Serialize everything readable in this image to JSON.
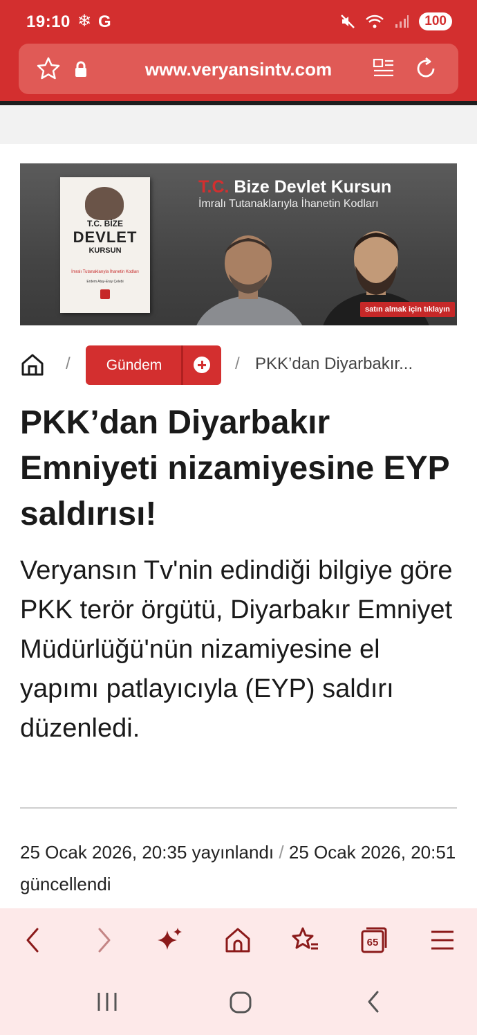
{
  "status_bar": {
    "time": "19:10",
    "carrier_glyph": "G",
    "battery": "100"
  },
  "browser": {
    "url": "www.veryansintv.com",
    "accent_color": "#d32f2f"
  },
  "banner": {
    "title_prefix": "T.C.",
    "title_rest": "Bize Devlet Kursun",
    "subtitle": "İmralı Tutanaklarıyla İhanetin Kodları",
    "book_line1": "T.C. BİZE",
    "book_line2": "DEVLET",
    "book_line3": "KURSUN",
    "book_subtitle": "İmralı Tutanaklarıyla İhanetin Kodları",
    "book_authors": "Erdem Atay-Eray Çelebi",
    "cta": "satın almak için tıklayın"
  },
  "breadcrumb": {
    "separator": "/",
    "category": "Gündem",
    "current": "PKK’dan Diyarbakır..."
  },
  "article": {
    "headline": "PKK’dan Diyarbakır Emniyeti nizamiyesine EYP saldırısı!",
    "lead": "Veryansın Tv'nin edindiği bilgiye göre PKK terör örgütü, Diyarbakır Emniyet Müdürlüğü'nün nizamiyesine el yapımı patlayıcıyla (EYP) saldırı düzenledi.",
    "published": "25 Ocak 2026, 20:35 yayınlandı",
    "meta_separator": "/",
    "updated": "25 Ocak 2026, 20:51 güncellendi"
  },
  "toolbar": {
    "tabs_count": "65",
    "icons": [
      "back-icon",
      "forward-icon",
      "sparkle-icon",
      "home-icon",
      "bookmarks-icon",
      "tabs-icon",
      "menu-icon"
    ]
  }
}
